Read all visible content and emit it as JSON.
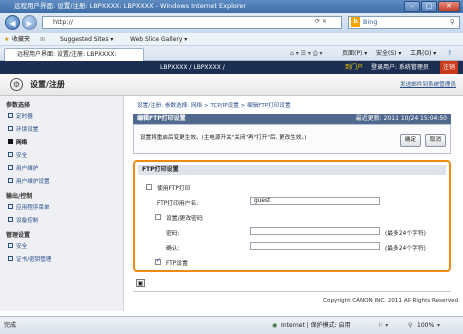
{
  "window": {
    "title": "远程用户界面: 设置/注册: LBPXXXX: LBPXXXX - Windows Internet Explorer"
  },
  "browser": {
    "address": "http://",
    "search_placeholder": "Bing",
    "favorites": "收藏夹",
    "suggested_sites": "Suggested Sites ▾",
    "web_slice": "Web Slice Gallery ▾",
    "tab_title": "远程用户界面: 设置/注册: LBPXXXX: LBPXXXX",
    "cmd_page": "页面(P) ▾",
    "cmd_safety": "安全(S) ▾",
    "cmd_tools": "工具(O) ▾"
  },
  "device": {
    "model": "LBPXXXX / LBPXXXX /",
    "portal_link": "到门户",
    "login_user": "登录用户: 系统管理员",
    "logout": "注销"
  },
  "page": {
    "title": "设置/注册",
    "mail_link": "发送邮件到系统管理员"
  },
  "sidebar": {
    "sections": [
      {
        "title": "参数选择",
        "items": [
          "定时器",
          "环境设置",
          "网络",
          "安全",
          "用户维护",
          "用户维护设置"
        ]
      },
      {
        "title": "输出/控制",
        "items": [
          "应用程序菜单",
          "设备控制"
        ]
      },
      {
        "title": "管理设置",
        "items": [
          "安全",
          "证书/密钥管理"
        ]
      }
    ]
  },
  "main": {
    "breadcrumb": "设置/注册: 参数选择: 网络 > TCP/IP设置 > 编辑FTP打印设置",
    "section_title": "编辑FTP打印设置",
    "last_updated": "最近更新: 2011 10/24 15:04:50",
    "notice": "设置将重启后变更生效。(主电源开关\"关闭\"再\"打开\"后, 更改生效。)",
    "ok": "确定",
    "cancel": "取消"
  },
  "ftp": {
    "header": "FTP打印设置",
    "use_ftp": "使用FTP打印",
    "username_label": "FTP打印用户名:",
    "username_value": "guest",
    "set_password": "设置/更改密码",
    "password_label": "密码:",
    "password_hint": "(最多24个字符)",
    "confirm_label": "确认:",
    "confirm_hint": "(最多24个字符)",
    "ftp_setting": "FTP设置"
  },
  "footer": {
    "copyright": "Copyright CANON INC. 2011 All Rights Reserved"
  },
  "status": {
    "left": "完成",
    "zone": "Internet | 保护模式: 启用",
    "zoom": "100%"
  }
}
